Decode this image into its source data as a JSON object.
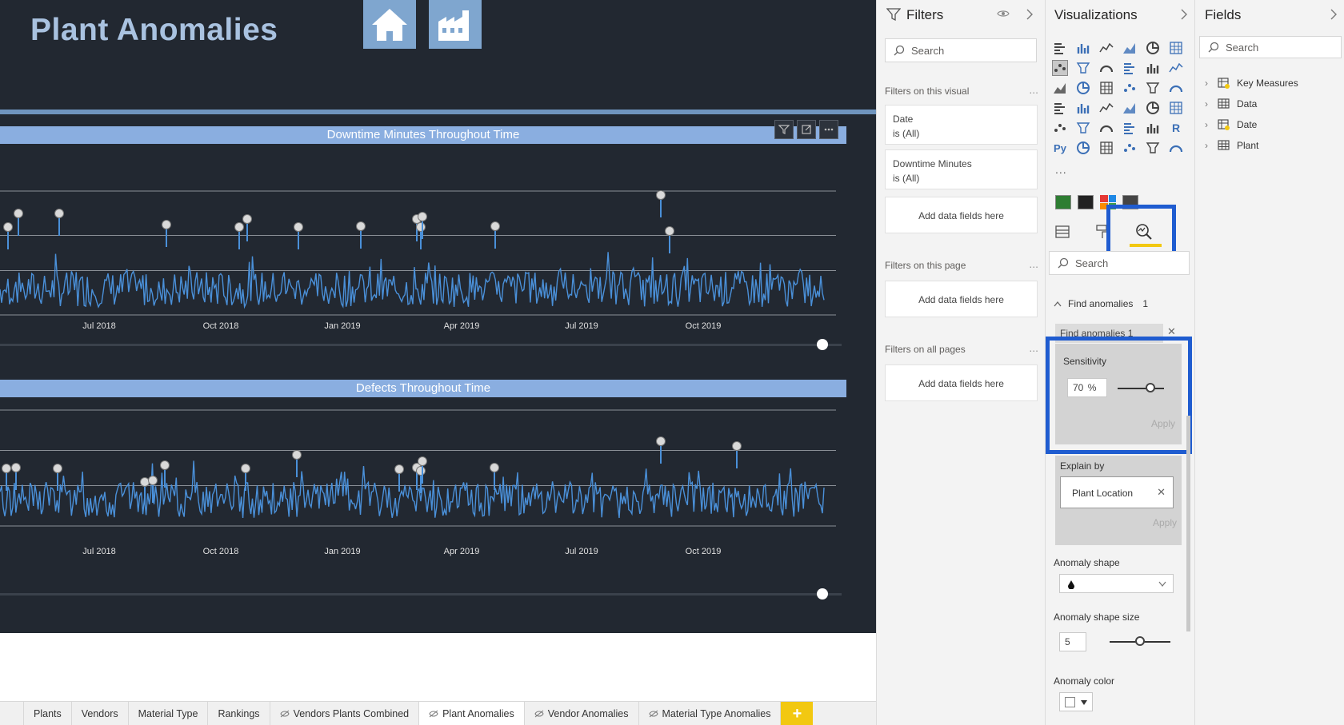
{
  "canvas": {
    "title": "Plant Anomalies",
    "nav": [
      {
        "icon": "home-icon"
      },
      {
        "icon": "factory-icon"
      }
    ]
  },
  "visual1": {
    "title": "Downtime Minutes Throughout Time",
    "x_ticks": [
      "Jul 2018",
      "Oct 2018",
      "Jan 2019",
      "Apr 2019",
      "Jul 2019",
      "Oct 2019"
    ]
  },
  "visual2": {
    "title": "Defects Throughout Time",
    "x_ticks": [
      "Jul 2018",
      "Oct 2018",
      "Jan 2019",
      "Apr 2019",
      "Jul 2019",
      "Oct 2019"
    ]
  },
  "chart_data": [
    {
      "type": "line",
      "title": "Downtime Minutes Throughout Time",
      "x_tick_labels": [
        "Jul 2018",
        "Oct 2018",
        "Jan 2019",
        "Apr 2019",
        "Jul 2019",
        "Oct 2019"
      ],
      "series_color": "#4a90d9",
      "anomaly_marker_count": 19,
      "grid": true
    },
    {
      "type": "line",
      "title": "Defects Throughout Time",
      "x_tick_labels": [
        "Jul 2018",
        "Oct 2018",
        "Jan 2019",
        "Apr 2019",
        "Jul 2019",
        "Oct 2019"
      ],
      "series_color": "#4a90d9",
      "anomaly_marker_count": 20,
      "grid": true
    }
  ],
  "tabs": [
    {
      "label": "Plants",
      "icon": false
    },
    {
      "label": "Vendors",
      "icon": false
    },
    {
      "label": "Material Type",
      "icon": false
    },
    {
      "label": "Rankings",
      "icon": false
    },
    {
      "label": "Vendors Plants Combined",
      "icon": true
    },
    {
      "label": "Plant Anomalies",
      "icon": true,
      "active": true
    },
    {
      "label": "Vendor Anomalies",
      "icon": true
    },
    {
      "label": "Material Type Anomalies",
      "icon": true
    }
  ],
  "tab_add_label": "+",
  "filters": {
    "title": "Filters",
    "search_placeholder": "Search",
    "on_visual_label": "Filters on this visual",
    "card1_name": "Date",
    "card1_value": "is (All)",
    "card2_name": "Downtime Minutes",
    "card2_value": "is (All)",
    "add_label": "Add data fields here",
    "on_page_label": "Filters on this page",
    "all_pages_label": "Filters on all pages",
    "dots": "..."
  },
  "visualizations": {
    "title": "Visualizations",
    "search_placeholder": "Search",
    "more": "...",
    "find_anomalies_header": "Find anomalies",
    "find_anomalies_count": "1",
    "find_anomalies_tab": "Find anomalies 1",
    "sensitivity_label": "Sensitivity",
    "sensitivity_value": "70",
    "sensitivity_unit": "%",
    "sensitivity_level": 0.7,
    "apply_label": "Apply",
    "explain_by_label": "Explain by",
    "explain_by_value": "Plant Location",
    "anomaly_shape_label": "Anomaly shape",
    "anomaly_shape_size_label": "Anomaly shape size",
    "anomaly_shape_size_value": "5",
    "anomaly_color_label": "Anomaly color",
    "highlight_color": "#1f5cd0"
  },
  "fields": {
    "title": "Fields",
    "search_placeholder": "Search",
    "items": [
      {
        "label": "Key Measures"
      },
      {
        "label": "Data"
      },
      {
        "label": "Date"
      },
      {
        "label": "Plant"
      }
    ]
  }
}
